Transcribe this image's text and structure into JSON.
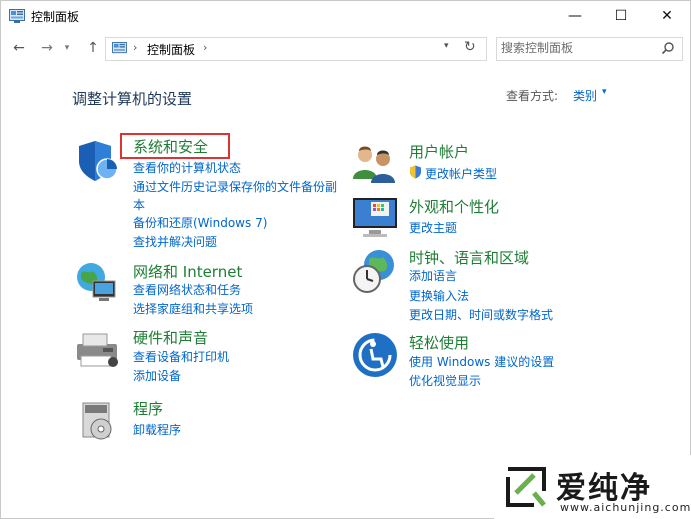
{
  "window": {
    "title": "控制面板",
    "controls": {
      "minimize": "—",
      "maximize": "☐",
      "close": "✕"
    }
  },
  "nav": {
    "back": "←",
    "forward": "→",
    "recent": "▾",
    "up": "↑",
    "breadcrumb": "控制面板",
    "separator": "›",
    "dropdown": "▾",
    "refresh": "↻"
  },
  "search": {
    "placeholder": "搜索控制面板"
  },
  "main": {
    "heading": "调整计算机的设置",
    "view_by_label": "查看方式:",
    "view_by_value": "类别",
    "view_by_arrow": "▾"
  },
  "categories": {
    "system": {
      "title": "系统和安全",
      "links": [
        "查看你的计算机状态",
        "通过文件历史记录保存你的文件备份副",
        "本",
        "备份和还原(Windows 7)",
        "查找并解决问题"
      ]
    },
    "network": {
      "title": "网络和 Internet",
      "links": [
        "查看网络状态和任务",
        "选择家庭组和共享选项"
      ]
    },
    "hardware": {
      "title": "硬件和声音",
      "links": [
        "查看设备和打印机",
        "添加设备"
      ]
    },
    "programs": {
      "title": "程序",
      "links": [
        "卸载程序"
      ]
    },
    "users": {
      "title": "用户帐户",
      "links": [
        "更改帐户类型"
      ]
    },
    "appearance": {
      "title": "外观和个性化",
      "links": [
        "更改主题"
      ]
    },
    "clock": {
      "title": "时钟、语言和区域",
      "links": [
        "添加语言",
        "更换输入法",
        "更改日期、时间或数字格式"
      ]
    },
    "ease": {
      "title": "轻松使用",
      "links": [
        "使用 Windows 建议的设置",
        "优化视觉显示"
      ]
    }
  },
  "watermark": {
    "text": "爱纯净",
    "url": "www.aichunjing.com"
  },
  "colors": {
    "title_green": "#1e7e34",
    "link_blue": "#0066cc",
    "heading": "#1e395b",
    "highlight": "#dd3333"
  }
}
